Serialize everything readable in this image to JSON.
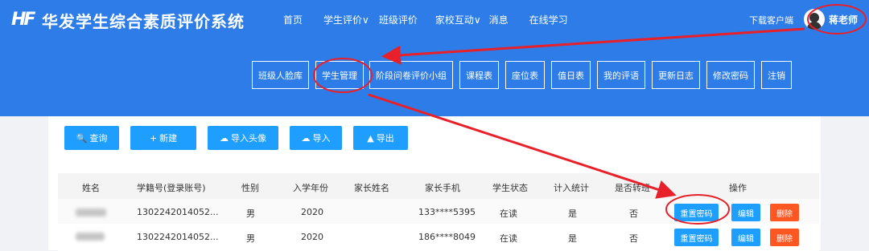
{
  "brand": {
    "logo": "HF",
    "title": "华发学生综合素质评价系统"
  },
  "topnav": [
    "首页",
    "学生评价∨",
    "班级评价",
    "家校互动∨",
    "消息",
    "在线学习"
  ],
  "download": "下载客户端",
  "user": {
    "name": "蒋老师"
  },
  "subnav": [
    "班级人脸库",
    "学生管理",
    "阶段问卷评价小组",
    "课程表",
    "座位表",
    "值日表",
    "我的评语",
    "更新日志",
    "修改密码",
    "注销"
  ],
  "toolbar": [
    {
      "icon": "search-icon",
      "glyph": "🔍",
      "label": "查询"
    },
    {
      "icon": "plus-icon",
      "glyph": "+",
      "label": "新建"
    },
    {
      "icon": "cloud-upload-icon",
      "glyph": "☁",
      "label": "导入头像"
    },
    {
      "icon": "cloud-upload-icon",
      "glyph": "☁",
      "label": "导入"
    },
    {
      "icon": "export-icon",
      "glyph": "▲",
      "label": "导出"
    }
  ],
  "table": {
    "headers": [
      "姓名",
      "学籍号(登录账号)",
      "性别",
      "入学年份",
      "家长姓名",
      "家长手机",
      "学生状态",
      "计入统计",
      "是否转班",
      "操作"
    ],
    "rows": [
      {
        "id": "1302242014052...",
        "gender": "男",
        "year": "2020",
        "parent": "",
        "phone": "133****5395",
        "status": "在读",
        "counted": "是",
        "transferred": "否"
      },
      {
        "id": "1302242014052...",
        "gender": "男",
        "year": "2020",
        "parent": "",
        "phone": "186****8049",
        "status": "在读",
        "counted": "是",
        "transferred": "否"
      }
    ],
    "actions": {
      "reset": "重置密码",
      "edit": "编辑",
      "delete": "删除"
    }
  },
  "colors": {
    "header": "#2d7ce8",
    "button": "#1e9fff",
    "danger": "#ff5722",
    "annotation": "#e8202a"
  }
}
